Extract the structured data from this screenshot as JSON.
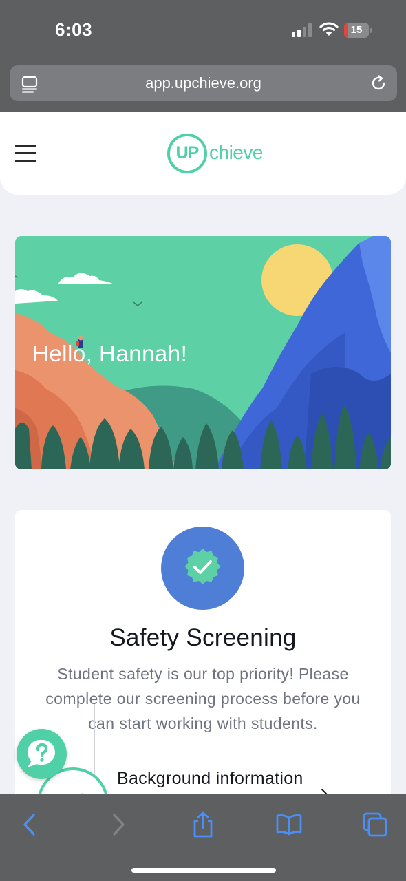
{
  "status_bar": {
    "time": "6:03",
    "battery_level": "15",
    "icons": [
      "signal-icon",
      "wifi-icon",
      "battery-icon"
    ]
  },
  "browser": {
    "url": "app.upchieve.org",
    "icons": [
      "reader-mode-icon",
      "reload-icon"
    ]
  },
  "header": {
    "menu_icon": "hamburger-menu-icon",
    "logo": {
      "up": "UP",
      "rest": "chieve"
    }
  },
  "hero": {
    "greeting": "Hello, Hannah!"
  },
  "screening_card": {
    "badge_icon": "verified-check-badge-icon",
    "title": "Safety Screening",
    "description": "Student safety is our top priority! Please complete our screening process before you can start working with students.",
    "step": {
      "label": "Background information",
      "icon": "check-circle-icon"
    }
  },
  "help_button": {
    "icon": "question-mark-icon"
  },
  "toolbar": {
    "icons": [
      "back-icon",
      "forward-icon",
      "share-icon",
      "bookmarks-icon",
      "tabs-icon"
    ]
  },
  "colors": {
    "brand_green": "#4fd0a7",
    "badge_blue": "#4e7ed5",
    "chrome_gray": "#5e5f61",
    "page_bg": "#f0f1f6"
  }
}
